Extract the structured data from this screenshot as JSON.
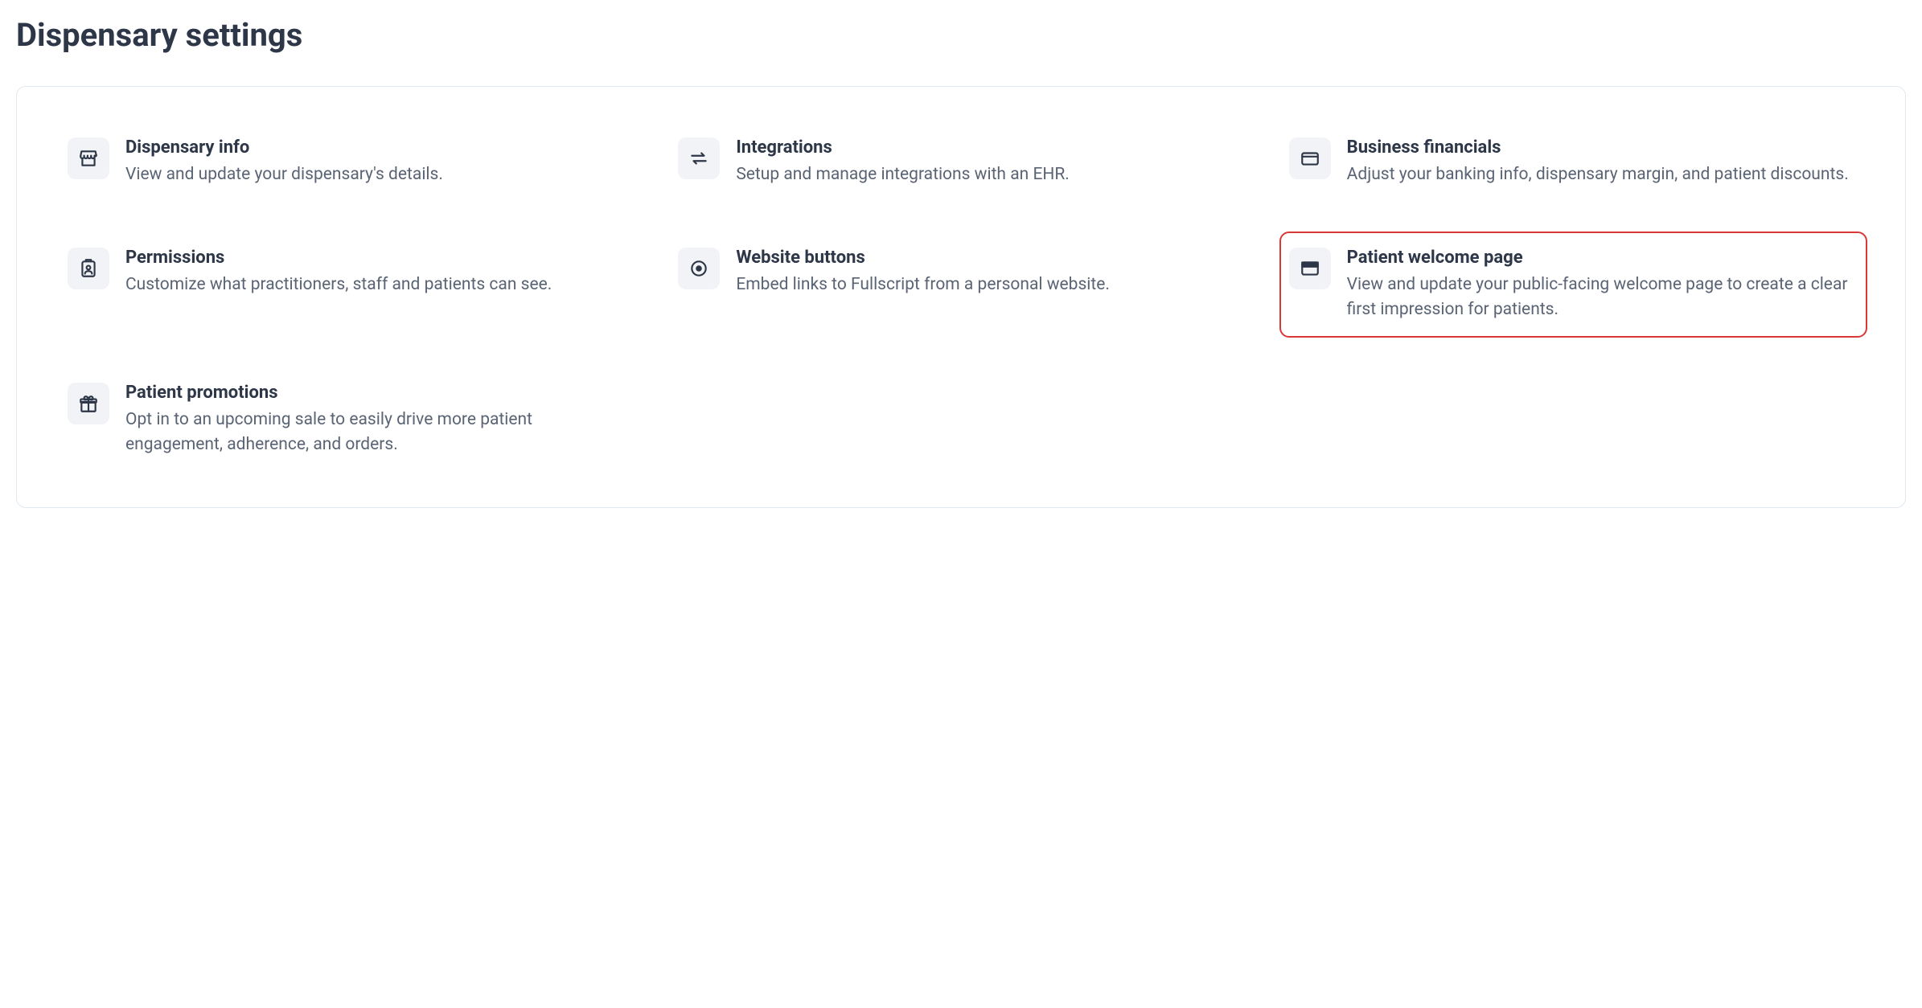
{
  "page": {
    "title": "Dispensary settings"
  },
  "cards": {
    "dispensary_info": {
      "title": "Dispensary info",
      "desc": "View and update your dispensary's details."
    },
    "integrations": {
      "title": "Integrations",
      "desc": "Setup and manage integrations with an EHR."
    },
    "business_financials": {
      "title": "Business financials",
      "desc": "Adjust your banking info, dispensary margin, and patient discounts."
    },
    "permissions": {
      "title": "Permissions",
      "desc": "Customize what practitioners, staff and patients can see."
    },
    "website_buttons": {
      "title": "Website buttons",
      "desc": "Embed links to Fullscript from a personal website."
    },
    "patient_welcome": {
      "title": "Patient welcome page",
      "desc": "View and update your public-facing welcome page to create a clear first impression for patients."
    },
    "patient_promotions": {
      "title": "Patient promotions",
      "desc": "Opt in to an upcoming sale to easily drive more patient engagement, adherence, and orders."
    }
  }
}
